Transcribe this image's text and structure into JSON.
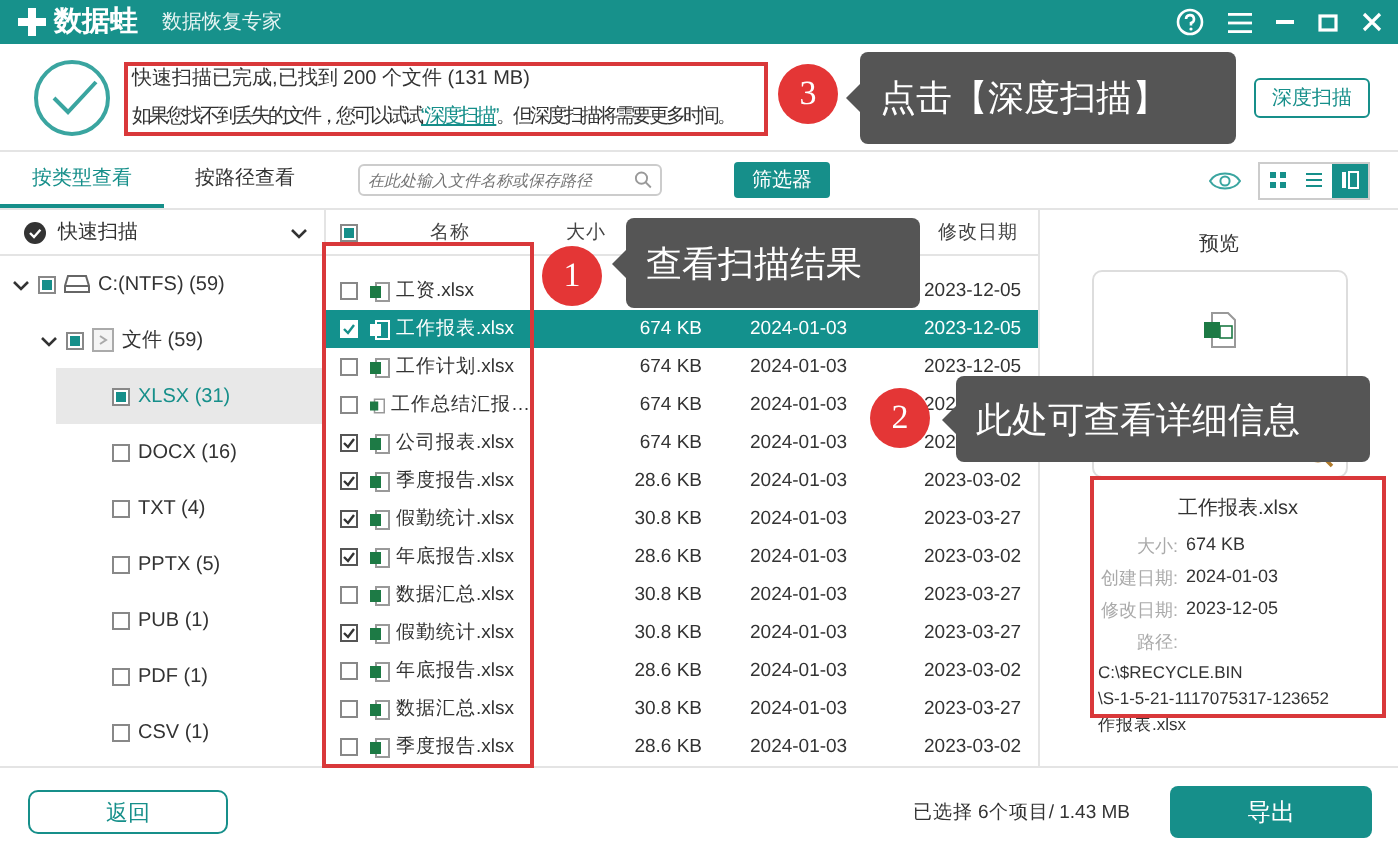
{
  "window": {
    "app_name": "数据蛙",
    "subtitle": "数据恢复专家"
  },
  "scan_summary": {
    "line1": "快速扫描已完成,已找到 200 个文件 (131 MB)",
    "line2_before": "如果您找不到丢失的文件，您可以试试",
    "line2_link": "“深度扫描”",
    "line2_after": "。但深度扫描将需要更多时间。",
    "deep_scan_button": "深度扫描"
  },
  "tabs": [
    {
      "label": "按类型查看",
      "selected": true
    },
    {
      "label": "按路径查看",
      "selected": false
    }
  ],
  "search": {
    "placeholder": "在此处输入文件名称或保存路径"
  },
  "filter_button": "筛选器",
  "view_modes": [
    {
      "kind": "grid",
      "selected": false
    },
    {
      "kind": "list",
      "selected": false
    },
    {
      "kind": "panel",
      "selected": true
    }
  ],
  "sidebar": {
    "scan_mode": "快速扫描",
    "tree": [
      {
        "label": "C:(NTFS) (59)",
        "kind": "drive",
        "mixed": true,
        "selected": false,
        "expanded": true,
        "children": [
          {
            "label": "文件 (59)",
            "kind": "folder",
            "mixed": true,
            "selected": false,
            "expanded": true,
            "children": [
              {
                "label": "XLSX (31)",
                "mixed": true,
                "selected": true
              },
              {
                "label": "DOCX (16)",
                "checked": false,
                "mixed": false,
                "selected": false
              },
              {
                "label": "TXT (4)",
                "checked": false,
                "mixed": false,
                "selected": false
              },
              {
                "label": "PPTX (5)",
                "checked": false,
                "mixed": false,
                "selected": false
              },
              {
                "label": "PUB (1)",
                "checked": false,
                "mixed": false,
                "selected": false
              },
              {
                "label": "PDF (1)",
                "checked": false,
                "mixed": false,
                "selected": false
              },
              {
                "label": "CSV (1)",
                "checked": false,
                "mixed": false,
                "selected": false
              }
            ]
          }
        ]
      }
    ]
  },
  "table": {
    "header_mixed": true,
    "header": {
      "name": "名称",
      "size": "大小",
      "modified": "修改日期"
    },
    "rows": [
      {
        "name": "工资.xlsx",
        "modified": "2023-12-05",
        "checked": false,
        "selected": false
      },
      {
        "name": "工作报表.xlsx",
        "size": "674 KB",
        "created": "2024-01-03",
        "modified": "2023-12-05",
        "checked": true,
        "selected": true
      },
      {
        "name": "工作计划.xlsx",
        "size": "674 KB",
        "created": "2024-01-03",
        "modified": "2023-12-05",
        "checked": false,
        "selected": false
      },
      {
        "name": "工作总结汇报…",
        "size": "674 KB",
        "created": "2024-01-03",
        "modified": "202",
        "checked": false,
        "selected": false
      },
      {
        "name": "公司报表.xlsx",
        "size": "674 KB",
        "created": "2024-01-03",
        "modified": "202",
        "checked": true,
        "selected": false
      },
      {
        "name": "季度报告.xlsx",
        "size": "28.6 KB",
        "created": "2024-01-03",
        "modified": "2023-03-02",
        "checked": true,
        "selected": false
      },
      {
        "name": "假勤统计.xlsx",
        "size": "30.8 KB",
        "created": "2024-01-03",
        "modified": "2023-03-27",
        "checked": true,
        "selected": false
      },
      {
        "name": "年底报告.xlsx",
        "size": "28.6 KB",
        "created": "2024-01-03",
        "modified": "2023-03-02",
        "checked": true,
        "selected": false
      },
      {
        "name": "数据汇总.xlsx",
        "size": "30.8 KB",
        "created": "2024-01-03",
        "modified": "2023-03-27",
        "checked": false,
        "selected": false
      },
      {
        "name": "假勤统计.xlsx",
        "size": "30.8 KB",
        "created": "2024-01-03",
        "modified": "2023-03-27",
        "checked": true,
        "selected": false
      },
      {
        "name": "年底报告.xlsx",
        "size": "28.6 KB",
        "created": "2024-01-03",
        "modified": "2023-03-02",
        "checked": false,
        "selected": false
      },
      {
        "name": "数据汇总.xlsx",
        "size": "30.8 KB",
        "created": "2024-01-03",
        "modified": "2023-03-27",
        "checked": false,
        "selected": false
      },
      {
        "name": "季度报告.xlsx",
        "size": "28.6 KB",
        "created": "2024-01-03",
        "modified": "2023-03-02",
        "checked": false,
        "selected": false
      }
    ]
  },
  "preview": {
    "title": "预览",
    "file_name": "工作报表.xlsx",
    "fields": [
      {
        "label": "大小:",
        "value": "674 KB"
      },
      {
        "label": "创建日期:",
        "value": "2024-01-03"
      },
      {
        "label": "修改日期:",
        "value": "2023-12-05"
      }
    ],
    "path_label": "路径:",
    "path_lines": [
      "C:\\$RECYCLE.BIN",
      "\\S-1-5-21-1117075317-123652",
      "作报表.xlsx"
    ]
  },
  "footer": {
    "back_button": "返回",
    "status": "已选择 6个项目/ 1.43 MB",
    "export_button": "导出"
  },
  "callouts": [
    {
      "number": "1",
      "text": "查看扫描结果"
    },
    {
      "number": "2",
      "text": "此处可查看详细信息"
    },
    {
      "number": "3",
      "text": "点击【深度扫描】"
    }
  ]
}
